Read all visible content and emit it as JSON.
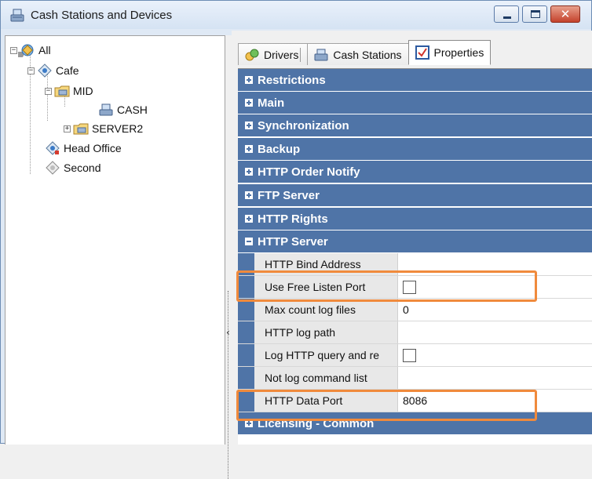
{
  "window": {
    "title": "Cash Stations and Devices",
    "controls": {
      "minimize": "minimize",
      "maximize": "maximize",
      "close": "✕"
    }
  },
  "tree": {
    "nodes": [
      {
        "label": "All",
        "icon": "network-icon"
      },
      {
        "label": "Cafe",
        "icon": "location-node-icon"
      },
      {
        "label": "MID",
        "icon": "folder-cash-icon"
      },
      {
        "label": "CASH",
        "icon": "cash-register-icon"
      },
      {
        "label": "SERVER2",
        "icon": "folder-cash-icon"
      },
      {
        "label": "Head Office",
        "icon": "location-node-icon"
      },
      {
        "label": "Second",
        "icon": "location-node-icon"
      }
    ]
  },
  "tabs": [
    {
      "label": "Drivers",
      "icon": "drivers-icon"
    },
    {
      "label": "Cash Stations",
      "icon": "cash-register-icon"
    },
    {
      "label": "Properties",
      "icon": "properties-icon"
    }
  ],
  "properties": {
    "categories_top": [
      "Restrictions",
      "Main",
      "Synchronization",
      "Backup",
      "HTTP Order Notify",
      "FTP Server",
      "HTTP Rights"
    ],
    "expanded_category": "HTTP Server",
    "rows": [
      {
        "name": "HTTP Bind Address",
        "value": ""
      },
      {
        "name": "Use Free Listen Port",
        "value": "",
        "checked": false
      },
      {
        "name": "Max count log files",
        "value": "0"
      },
      {
        "name": "HTTP log path",
        "value": ""
      },
      {
        "name": "Log HTTP query and re",
        "value": "",
        "checked": false
      },
      {
        "name": "Not log command list",
        "value": ""
      },
      {
        "name": "HTTP Data Port",
        "value": "8086"
      }
    ],
    "categories_bottom": [
      "Licensing - Common"
    ]
  },
  "colors": {
    "category_bg": "#4f74a7",
    "highlight": "#f08a3c"
  }
}
